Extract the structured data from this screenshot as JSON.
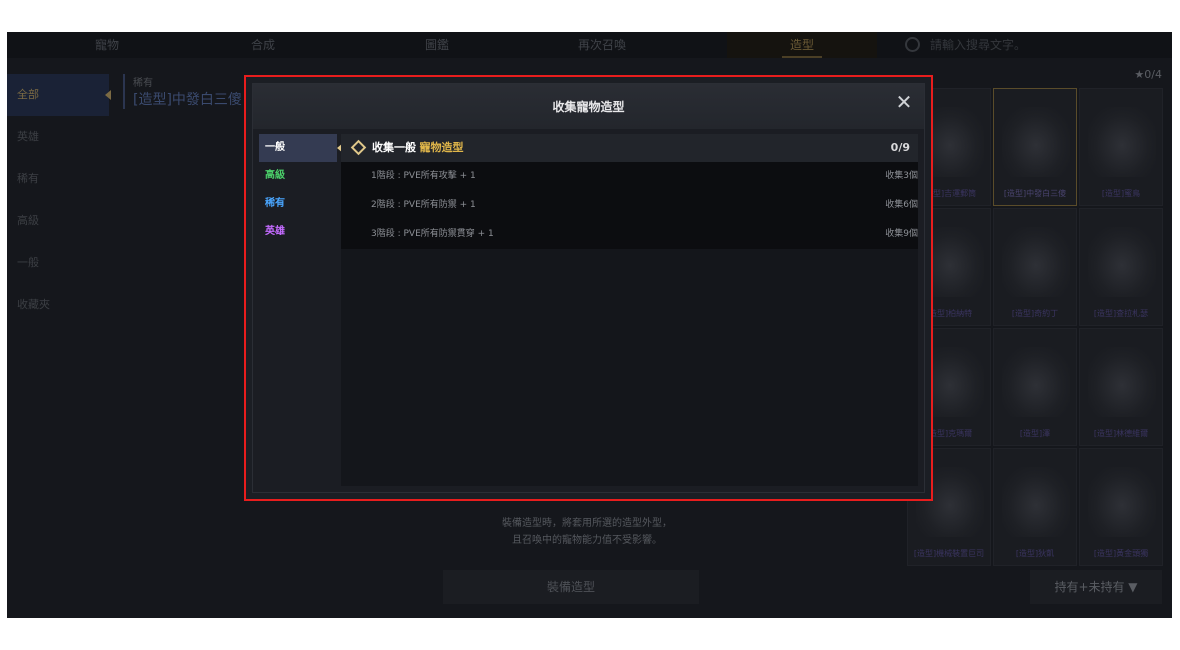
{
  "nav": {
    "tabs": [
      "寵物",
      "合成",
      "圖鑑",
      "再次召喚",
      "造型"
    ],
    "active_tab": "造型",
    "search_placeholder": "請輸入搜尋文字。"
  },
  "left_categories": [
    "全部",
    "英雄",
    "稀有",
    "高級",
    "一般",
    "收藏夾"
  ],
  "selected": {
    "rarity": "稀有",
    "name": "[造型]中發白三傻"
  },
  "count": "★0/4",
  "grid_items": [
    "[造型]吉運郵筒",
    "[造型]中發白三傻",
    "[造型]蜜鳥",
    "[造型]柏納特",
    "[造型]奇約丁",
    "[造型]查拉札瑟",
    "[造型]克瑪爾",
    "[造型]澤",
    "[造型]林德維爾",
    "[造型]機械裝置巨司",
    "[造型]狄凱",
    "[造型]黃金頭獨"
  ],
  "bottom": {
    "note_line1": "裝備造型時，將套用所選的造型外型，",
    "note_line2": "且召喚中的寵物能力值不受影響。",
    "equip_button": "裝備造型",
    "ownership_filter": "持有+未持有 ▼"
  },
  "modal": {
    "title": "收集寵物造型",
    "close_icon": "close-icon",
    "tabs": [
      {
        "label": "一般",
        "color": "#ffffff"
      },
      {
        "label": "高級",
        "color": "#4bd06a"
      },
      {
        "label": "稀有",
        "color": "#4aa6ff"
      },
      {
        "label": "英雄",
        "color": "#c46bff"
      }
    ],
    "active_tab": "一般",
    "collection": {
      "label": "收集一般",
      "highlight": "寵物造型",
      "progress": "0/9",
      "stages": [
        {
          "name": "1階段 : PVE所有攻擊 + 1",
          "requirement": "收集3個"
        },
        {
          "name": "2階段 : PVE所有防禦 + 1",
          "requirement": "收集6個"
        },
        {
          "name": "3階段 : PVE所有防禦貫穿 + 1",
          "requirement": "收集9個"
        }
      ]
    }
  }
}
